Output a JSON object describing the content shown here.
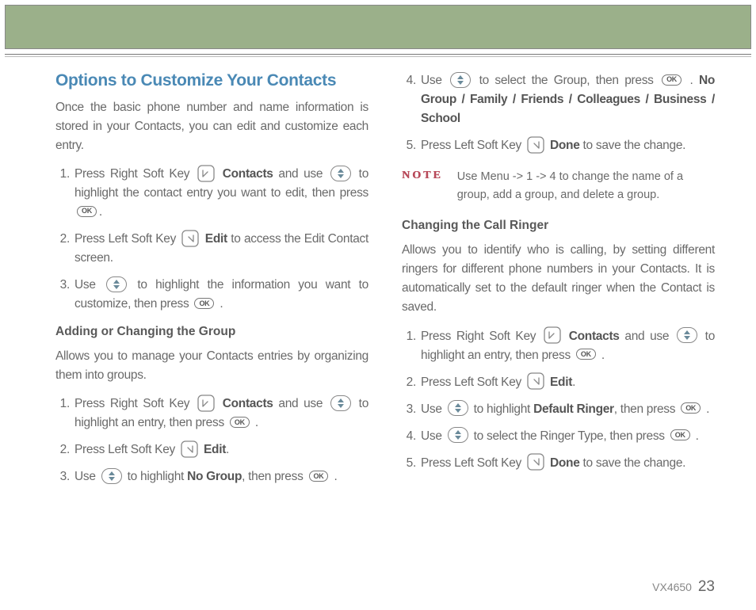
{
  "col1": {
    "heading": "Options to Customize Your Contacts",
    "intro": "Once the basic phone number and name information is stored in your Contacts, you can edit and customize each entry.",
    "steps": {
      "s1a": "Press Right Soft Key ",
      "s1b": " Contacts",
      "s1c": " and use ",
      "s1d": " to highlight the contact entry you want to edit, then press ",
      "s1e": ".",
      "s2a": "Press Left Soft Key ",
      "s2b": " Edit",
      "s2c": " to access the Edit Contact screen.",
      "s3a": "Use ",
      "s3b": " to highlight the information you want to customize, then press ",
      "s3c": " ."
    },
    "sub1_heading": "Adding or Changing the Group",
    "sub1_intro": "Allows you to manage your Contacts entries by organizing them into groups.",
    "sub1": {
      "s1a": "Press Right Soft Key ",
      "s1b": " Contacts",
      "s1c": " and use ",
      "s1d": " to highlight an entry, then press ",
      "s1e": " .",
      "s2a": "Press Left Soft Key ",
      "s2b": " Edit",
      "s2c": ".",
      "s3a": "Use ",
      "s3b": " to highlight ",
      "s3c": "No Group",
      "s3d": ", then press ",
      "s3e": " ."
    }
  },
  "col2": {
    "cont": {
      "s4a": "Use ",
      "s4b": " to select the Group, then press ",
      "s4c": " . ",
      "s4d": "No Group / Family / Friends / Colleagues / Business / School",
      "s5a": "Press Left Soft Key ",
      "s5b": " Done",
      "s5c": " to save the change."
    },
    "note_label": "NOTE",
    "note_text": "Use Menu -> 1 -> 4 to change the name of a group, add a group, and delete a group.",
    "sub2_heading": "Changing the Call Ringer",
    "sub2_intro": "Allows you to identify who is calling, by setting different ringers for different phone numbers in your Contacts. It is automatically set to the default ringer when the Contact is saved.",
    "sub2": {
      "s1a": "Press Right Soft Key ",
      "s1b": " Contacts",
      "s1c": " and use ",
      "s1d": " to highlight an entry, then press ",
      "s1e": " .",
      "s2a": "Press Left Soft Key ",
      "s2b": " Edit",
      "s2c": ".",
      "s3a": "Use ",
      "s3b": " to highlight ",
      "s3c": "Default Ringer",
      "s3d": ", then press ",
      "s3e": " .",
      "s4a": "Use ",
      "s4b": " to select the Ringer Type, then press ",
      "s4c": " .",
      "s5a": "Press Left Soft Key ",
      "s5b": " Done",
      "s5c": " to save the change."
    }
  },
  "footer": {
    "model": "VX4650",
    "page": "23"
  }
}
